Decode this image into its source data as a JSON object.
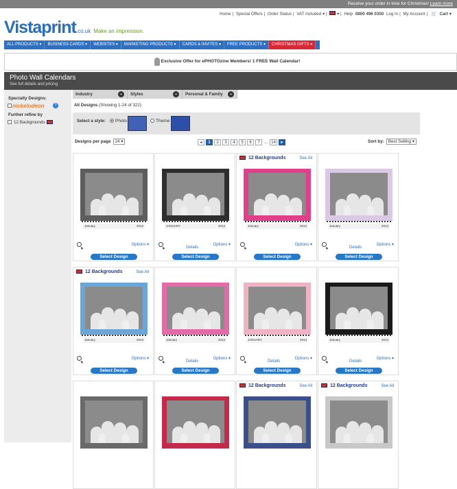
{
  "topbar": {
    "message": "Receive your order in time for Christmas!",
    "link": "Learn more"
  },
  "utility": {
    "home": "Home",
    "special_offers": "Special Offers",
    "order_status": "Order Status",
    "vat": "VAT included",
    "help": "Help",
    "phone": "0800 496 0350",
    "login": "Log In",
    "account": "My Account",
    "cart": "Cart"
  },
  "logo": {
    "brand": "Vistaprint",
    "tld": ".co.uk",
    "tagline": "Make an impression."
  },
  "nav": [
    "ALL PRODUCTS",
    "BUSINESS CARDS",
    "WEBSITES",
    "MARKETING PRODUCTS",
    "CARDS & INVITES",
    "FREE PRODUCTS",
    "CHRISTMAS GIFTS"
  ],
  "offer": {
    "text": "Exclusive Offer for ePHOTOzine Members! 1 FREE Wall Calendar!"
  },
  "header": {
    "title": "Photo Wall Calendars",
    "subtitle": "See full details and pricing"
  },
  "sidebar": {
    "specialty_label": "Specialty Designs:",
    "brand": "nickelodeon",
    "refine_label": "Further refine by",
    "refine_option": "12 Backgrounds"
  },
  "filters": [
    "Industry",
    "Styles",
    "Personal & Family"
  ],
  "summary": {
    "label": "All Designs",
    "count": "(Showing 1-24 of 322)"
  },
  "style_select": {
    "label": "Select a style:",
    "options": [
      "Photo",
      "Theme"
    ],
    "selected": "Photo"
  },
  "per_page": {
    "label": "Designs per page",
    "value": "24"
  },
  "pager": {
    "pages": [
      "1",
      "2",
      "3",
      "4",
      "5",
      "6",
      "7"
    ],
    "ellipsis": "...",
    "last": "14",
    "current": "1"
  },
  "sort": {
    "label": "Sort by:",
    "value": "Best Selling"
  },
  "card_labels": {
    "group": "12 Backgrounds",
    "see_all": "See All",
    "details": "Details",
    "options": "Options",
    "select": "Select Design"
  },
  "cards": [
    {
      "month": "January",
      "year": "2013",
      "group": false,
      "details": false,
      "frame": "#5d5d5d"
    },
    {
      "month": "JANUARY",
      "year": "2013",
      "group": false,
      "details": true,
      "frame": "#2e2e2e"
    },
    {
      "month": "January",
      "year": "2013",
      "group": true,
      "details": false,
      "frame": "#e0408a"
    },
    {
      "month": "January",
      "year": "2013",
      "group": false,
      "details": true,
      "frame": "#d9c8e6"
    },
    {
      "month": "January",
      "year": "2013",
      "group": true,
      "details": false,
      "frame": "#6aa6d8"
    },
    {
      "month": "January",
      "year": "2013",
      "group": false,
      "details": true,
      "frame": "#e56aa8"
    },
    {
      "month": "JANUARY",
      "year": "2013",
      "group": false,
      "details": true,
      "frame": "#f0b3c4"
    },
    {
      "month": "January",
      "year": "2013",
      "group": false,
      "details": true,
      "frame": "#1a1a1a"
    },
    {
      "month": "",
      "year": "",
      "group": false,
      "details": false,
      "frame": "#6a6a6a"
    },
    {
      "month": "",
      "year": "",
      "group": false,
      "details": false,
      "frame": "#c42a4a"
    },
    {
      "month": "",
      "year": "",
      "group": true,
      "details": false,
      "frame": "#3b4f8a"
    },
    {
      "month": "",
      "year": "",
      "group": true,
      "details": false,
      "frame": "#c8c8c8"
    }
  ]
}
